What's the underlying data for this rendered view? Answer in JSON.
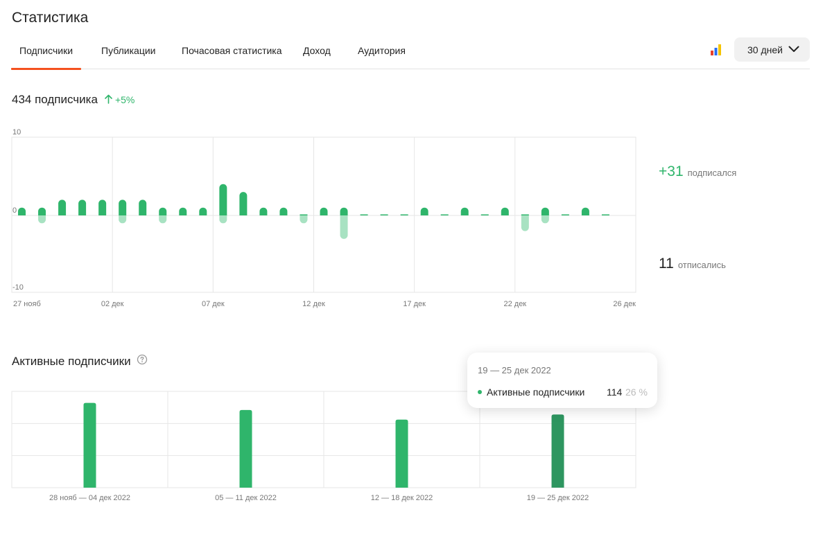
{
  "page": {
    "title": "Статистика"
  },
  "tabs": [
    {
      "label": "Подписчики",
      "active": true
    },
    {
      "label": "Публикации",
      "active": false
    },
    {
      "label": "Почасовая статистика",
      "active": false
    },
    {
      "label": "Доход",
      "active": false
    },
    {
      "label": "Аудитория",
      "active": false
    }
  ],
  "toolbar": {
    "chart_icon": "bar-chart-icon",
    "period_label": "30 дней",
    "period_icon": "chevron-down-icon"
  },
  "summary": {
    "subscribers": "434 подписчика",
    "growth": "+5%",
    "growth_icon": "arrow-up-icon",
    "subscribed_value": "+31",
    "subscribed_label": "подписался",
    "unsubscribed_value": "11",
    "unsubscribed_label": "отписались"
  },
  "colors": {
    "accent": "#f4511e",
    "positive": "#2fb56b",
    "negative_light": "#a8e2c2",
    "highlight": "#2e9660",
    "grid": "#e6e6e6"
  },
  "active_section": {
    "title": "Активные подписчики",
    "help_icon": "help-circle-icon"
  },
  "tooltip": {
    "title": "19 — 25 дек 2022",
    "label": "Активные подписчики",
    "value": "114",
    "percent": "26 %"
  },
  "chart_data": [
    {
      "type": "bar",
      "yticks": [
        "10",
        "0",
        "-10"
      ],
      "ylim": [
        -10,
        10
      ],
      "xticks": [
        "27 нояб",
        "02 дек",
        "07 дек",
        "12 дек",
        "17 дек",
        "22 дек",
        "26 дек"
      ],
      "grid": true,
      "days": 31,
      "series": [
        {
          "values": [
            1,
            1,
            2,
            2,
            2,
            2,
            2,
            1,
            1,
            1,
            4,
            3,
            1,
            1,
            0,
            1,
            1,
            0,
            0,
            0,
            1,
            0,
            1,
            0,
            1,
            0,
            1,
            0,
            1,
            0
          ]
        },
        {
          "values": [
            0,
            -1,
            0,
            0,
            0,
            -1,
            0,
            -1,
            0,
            0,
            -1,
            0,
            0,
            0,
            -1,
            0,
            -3,
            0,
            0,
            0,
            0,
            0,
            0,
            0,
            0,
            -2,
            -1,
            0,
            0,
            0
          ]
        }
      ]
    },
    {
      "type": "bar",
      "categories": [
        "28 нояб — 04 дек 2022",
        "05 — 11 дек 2022",
        "12 — 18 дек 2022",
        "19 — 25 дек 2022"
      ],
      "values": [
        132,
        121,
        106,
        114
      ],
      "ylim": [
        0,
        150
      ],
      "grid": true,
      "highlighted": 3
    }
  ]
}
